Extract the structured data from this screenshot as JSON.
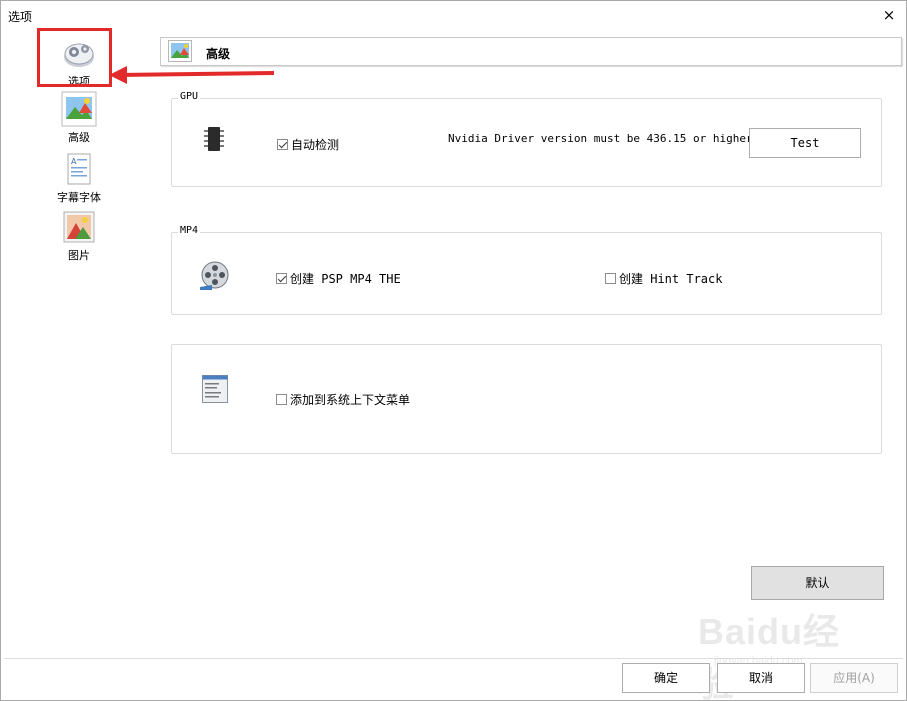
{
  "window": {
    "title": "选项",
    "close_glyph": "×"
  },
  "sidebar": {
    "items": [
      {
        "label": "选项",
        "icon": "options-gear-icon",
        "selected": true
      },
      {
        "label": "高级",
        "icon": "advanced-picture-icon"
      },
      {
        "label": "字幕字体",
        "icon": "subtitle-font-icon"
      },
      {
        "label": "图片",
        "icon": "picture-icon"
      }
    ]
  },
  "header": {
    "title": "高级",
    "icon": "advanced-picture-icon"
  },
  "gpu": {
    "group_label": "GPU",
    "icon": "chip-icon",
    "auto_detect": {
      "label": "自动检测",
      "checked": true
    },
    "driver_note": "Nvidia Driver version must be 436.15 or higher",
    "test_label": "Test"
  },
  "mp4": {
    "group_label": "MP4",
    "icon": "film-reel-icon",
    "create_psp": {
      "label": "创建 PSP MP4 THE",
      "checked": true
    },
    "create_hint": {
      "label": "创建 Hint Track",
      "checked": false
    }
  },
  "context": {
    "icon": "context-menu-icon",
    "add_menu": {
      "label": "添加到系统上下文菜单",
      "checked": false
    }
  },
  "buttons": {
    "default_label": "默认",
    "ok_label": "确定",
    "cancel_label": "取消",
    "apply_label": "应用(A)"
  },
  "watermark": {
    "text": "Baidu经验",
    "sub": "jingyan.baidu.com"
  },
  "colors": {
    "highlight": "#e32a2a",
    "border": "#dcdcdc",
    "grey_button": "#e1e1e1"
  }
}
